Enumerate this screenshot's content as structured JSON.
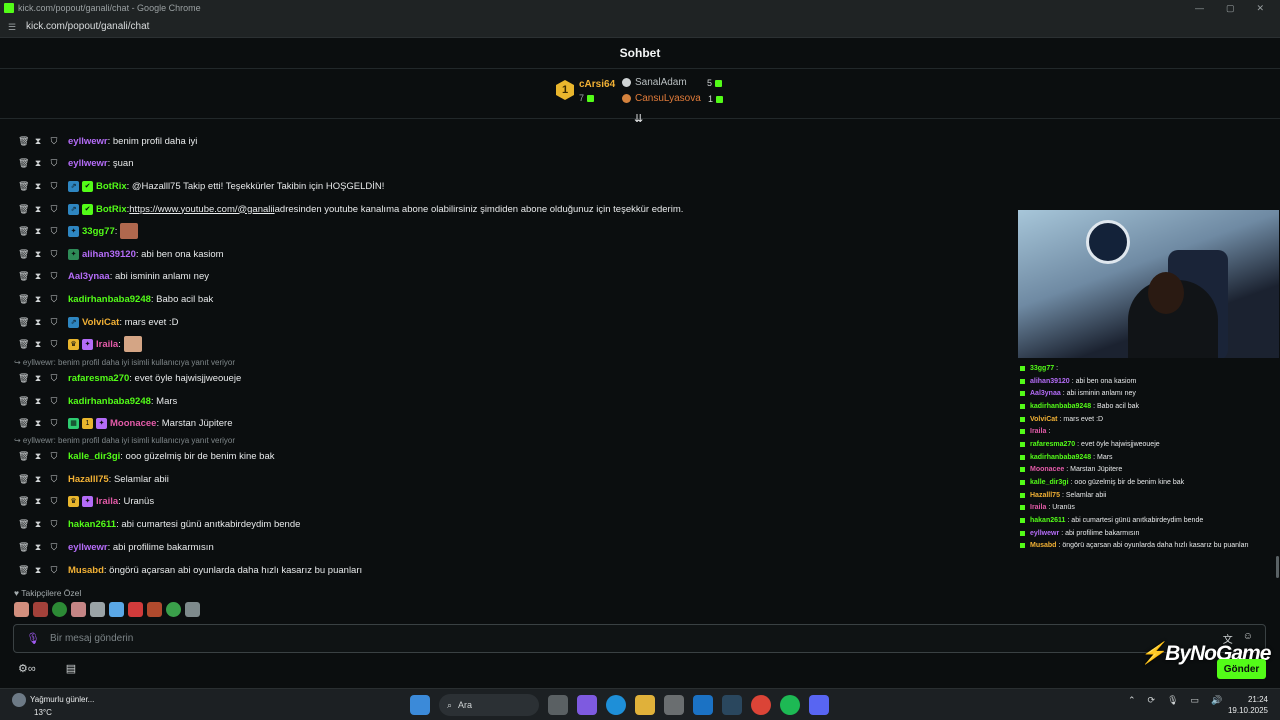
{
  "window": {
    "title": "kick.com/popout/ganali/chat - Google Chrome",
    "url": "kick.com/popout/ganali/chat"
  },
  "header": {
    "title": "Sohbet"
  },
  "leaderboard": {
    "first": {
      "rank": "1",
      "name": "cArsi64",
      "count": "7"
    },
    "second": {
      "name": "SanalAdam",
      "count": "5"
    },
    "third": {
      "name": "CansuLyasova",
      "count": "1"
    }
  },
  "messages": [
    {
      "user": "eyllwewr",
      "color": "#b46cf7",
      "text": ": benim profil daha iyi"
    },
    {
      "user": "eyllwewr",
      "color": "#b46cf7",
      "text": ": şuan"
    },
    {
      "user": "BotRix",
      "color": "#53fc18",
      "text": ": @Hazalll75 Takip etti! Teşekkürler Takibin için HOŞGELDİN!"
    },
    {
      "user": "BotRix",
      "color": "#53fc18",
      "text": ": ",
      "link": "https://www.youtube.com/@ganalii",
      "text2": " adresinden youtube kanalıma abone olabilirsiniz şimdiden abone olduğunuz için teşekkür ederim."
    },
    {
      "user": "33gg77",
      "color": "#53fc18",
      "text": ":"
    },
    {
      "user": "alihan39120",
      "color": "#b46cf7",
      "text": ": abi ben ona kasiom"
    },
    {
      "user": "Aal3ynaa",
      "color": "#b46cf7",
      "text": ": abi isminin anlamı ney"
    },
    {
      "user": "kadirhanbaba9248",
      "color": "#53fc18",
      "text": ": Babo acil bak"
    },
    {
      "user": "VolviCat",
      "color": "#f2b135",
      "text": ": mars evet :D"
    },
    {
      "user": "Iraila",
      "color": "#e35ba8",
      "text": ":"
    },
    {
      "user": "rafaresma270",
      "color": "#53fc18",
      "text": ": evet öyle hajwisjjweoueje"
    },
    {
      "user": "kadirhanbaba9248",
      "color": "#53fc18",
      "text": ": Mars"
    },
    {
      "user": "Moonacee",
      "color": "#e35ba8",
      "text": ": Marstan Jüpitere"
    },
    {
      "user": "kalle_dir3gi",
      "color": "#53fc18",
      "text": ": ooo güzelmiş bir de benim kine bak"
    },
    {
      "user": "Hazalll75",
      "color": "#f2b135",
      "text": ": Selamlar abii"
    },
    {
      "user": "Iraila",
      "color": "#e35ba8",
      "text": ": Uranüs"
    },
    {
      "user": "hakan2611",
      "color": "#53fc18",
      "text": ": abi cumartesi günü anıtkabirdeydim bende"
    },
    {
      "user": "eyllwewr",
      "color": "#b46cf7",
      "text": ": abi profilime bakarmısın"
    },
    {
      "user": "Musabd",
      "color": "#f2b135",
      "text": ": öngörü açarsan abi oyunlarda daha hızlı kasarız bu puanları"
    }
  ],
  "replies": {
    "r1": "eyllwewr: benim profil daha iyi isimli kullanıcıya yanıt veriyor",
    "r2": "eyllwewr: benim profil daha iyi isimli kullanıcıya yanıt veriyor"
  },
  "followers_label": "Takipçilere Özel",
  "input": {
    "placeholder": "Bir mesaj gönderin"
  },
  "send_label": "Gönder",
  "watermark": {
    "a": "By",
    "b": "NoGame"
  },
  "overlay_chat": [
    {
      "user": "33gg77",
      "color": "#53fc18",
      "text": ":"
    },
    {
      "user": "alihan39120",
      "color": "#b46cf7",
      "text": ": abi ben ona kasiom"
    },
    {
      "user": "Aal3ynaa",
      "color": "#b46cf7",
      "text": ": abi isminin anlamı ney"
    },
    {
      "user": "kadirhanbaba9248",
      "color": "#53fc18",
      "text": ": Babo acil bak"
    },
    {
      "user": "VolviCat",
      "color": "#f2b135",
      "text": ": mars evet :D"
    },
    {
      "user": "Iraila",
      "color": "#e35ba8",
      "text": ":"
    },
    {
      "user": "rafaresma270",
      "color": "#53fc18",
      "text": ": evet öyle hajwisjjweoueje"
    },
    {
      "user": "kadirhanbaba9248",
      "color": "#53fc18",
      "text": ": Mars"
    },
    {
      "user": "Moonacee",
      "color": "#e35ba8",
      "text": ": Marstan Jüpitere"
    },
    {
      "user": "kalle_dir3gi",
      "color": "#53fc18",
      "text": ": ooo güzelmiş bir de benim kine bak"
    },
    {
      "user": "Hazalll75",
      "color": "#f2b135",
      "text": ": Selamlar abii"
    },
    {
      "user": "Iraila",
      "color": "#e35ba8",
      "text": ": Uranüs"
    },
    {
      "user": "hakan2611",
      "color": "#53fc18",
      "text": ": abi cumartesi günü anıtkabirdeydim bende"
    },
    {
      "user": "eyllwewr",
      "color": "#b46cf7",
      "text": ": abi profilime bakarmısın"
    },
    {
      "user": "Musabd",
      "color": "#f2b135",
      "text": ": öngörü açarsan abi oyunlarda daha hızlı kasarız bu puanları"
    }
  ],
  "taskbar": {
    "weather_title": "Yağmurlu günler...",
    "weather_temp": "13°C",
    "search": "Ara",
    "time": "21:24",
    "date": "19.10.2025"
  },
  "colors": {
    "accent": "#53fc18",
    "background": "#0b0e0f"
  }
}
